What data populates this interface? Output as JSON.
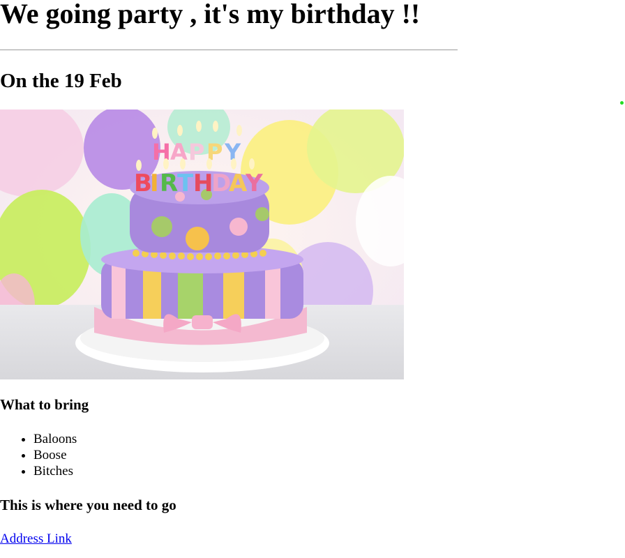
{
  "heading": "We going party , it's my birthday !!",
  "date": "On the 19 Feb",
  "image": {
    "description_icon": "birthday-cake-photo",
    "topper_line1": "HAPPY",
    "topper_line2": "BIRTHDAY"
  },
  "bring": {
    "title": "What to bring",
    "items": [
      "Baloons",
      "Boose",
      "Bitches"
    ]
  },
  "where": {
    "title": "This is where you need to go",
    "link_label": "Address Link"
  },
  "colors": {
    "link": "#0000ee",
    "rule": "#9a9a9a",
    "dot": "#22dd22"
  }
}
